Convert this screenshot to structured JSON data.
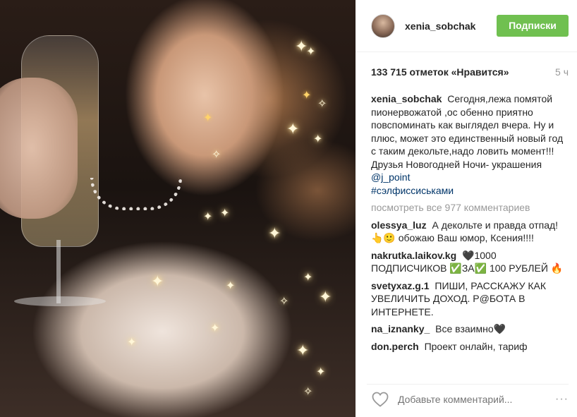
{
  "post": {
    "username": "xenia_sobchak",
    "follow_label": "Подписки",
    "likes_text": "133 715 отметок «Нравится»",
    "time_ago": "5 ч",
    "caption": {
      "user": "xenia_sobchak",
      "text": "Сегодня,лежа помятой пионервожатой ,ос обенно приятно повспоминать как выглядел вчера. Ну и плюс, может это единственный новый год с таким декольте,надо ловить момент!!!Друзья Новогодней Ночи- украшения",
      "mention": "@j_point",
      "hashtag": "#сэлфиссиськами"
    },
    "view_all": "посмотреть все 977 комментариев",
    "comments": [
      {
        "user": "olessya_luz",
        "text": "А декольте и правда отпад! 👆🙂 обожаю Ваш юмор, Ксения!!!!"
      },
      {
        "user": "nakrutka.laikov.kg",
        "text": "🖤1000 ПОДПИСЧИКОВ ✅ЗА✅ 100 РУБЛЕЙ 🔥"
      },
      {
        "user": "svetyxaz.g.1",
        "text": "ПИШИ, РАССКАЖУ КАК УВЕЛИЧИТЬ ДОХОД. Р@БОТА В ИНТЕРНЕТЕ."
      },
      {
        "user": "na_iznanky_",
        "text": "Все взаимно🖤"
      },
      {
        "user": "don.perch",
        "text": "Проект онлайн, тариф"
      }
    ],
    "add_comment_placeholder": "Добавьте комментарий...",
    "more_glyph": "···"
  },
  "icons": {
    "like": "heart-outline-icon",
    "options": "more-options-icon",
    "sparkle": "sparkle-icon"
  },
  "colors": {
    "follow_bg": "#70c050",
    "link": "#003569",
    "muted": "#999999"
  }
}
